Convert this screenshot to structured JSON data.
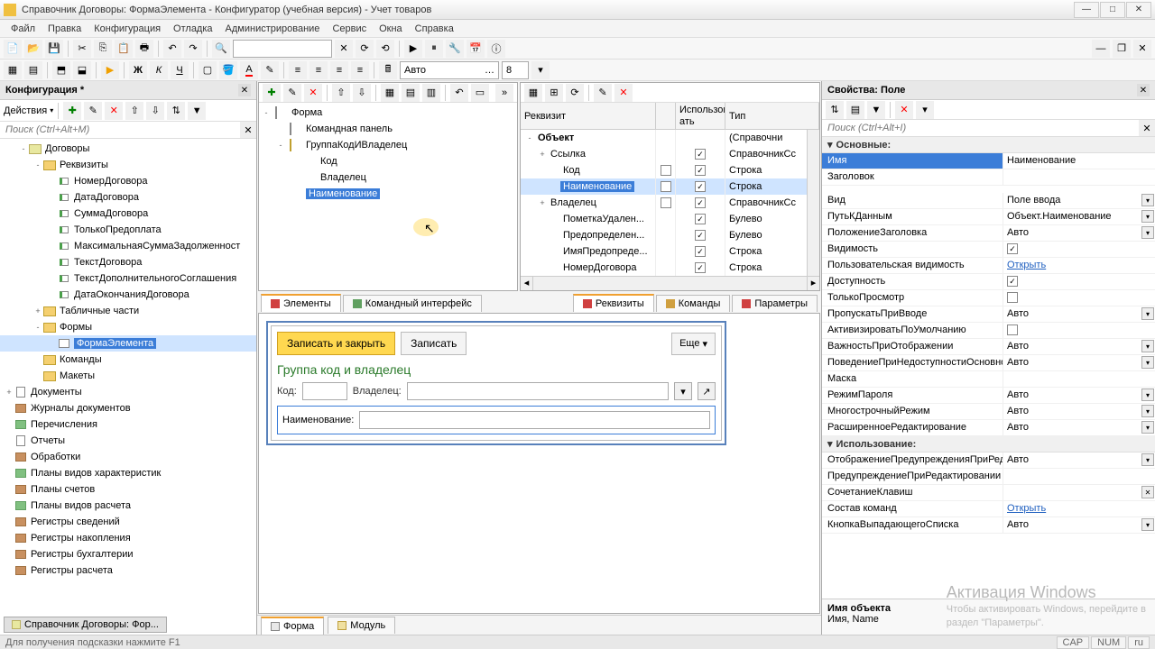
{
  "titlebar": "Справочник Договоры: ФормаЭлемента - Конфигуратор (учебная версия) - Учет товаров",
  "menu": [
    "Файл",
    "Правка",
    "Конфигурация",
    "Отладка",
    "Администрирование",
    "Сервис",
    "Окна",
    "Справка"
  ],
  "toolbar2": {
    "combo_font": "Авто",
    "combo_size": "8"
  },
  "left": {
    "title": "Конфигурация *",
    "actions": "Действия",
    "search_ph": "Поиск (Ctrl+Alt+M)",
    "tree": [
      {
        "l": 1,
        "ex": "-",
        "i": "book",
        "t": "Договоры"
      },
      {
        "l": 2,
        "ex": "-",
        "i": "folder",
        "t": "Реквизиты"
      },
      {
        "l": 3,
        "ex": "",
        "i": "attr",
        "t": "НомерДоговора"
      },
      {
        "l": 3,
        "ex": "",
        "i": "attr",
        "t": "ДатаДоговора"
      },
      {
        "l": 3,
        "ex": "",
        "i": "attr",
        "t": "СуммаДоговора"
      },
      {
        "l": 3,
        "ex": "",
        "i": "attr",
        "t": "ТолькоПредоплата"
      },
      {
        "l": 3,
        "ex": "",
        "i": "attr",
        "t": "МаксимальнаяСуммаЗадолженност"
      },
      {
        "l": 3,
        "ex": "",
        "i": "attr",
        "t": "ТекстДоговора"
      },
      {
        "l": 3,
        "ex": "",
        "i": "attr",
        "t": "ТекстДополнительногоСоглашения"
      },
      {
        "l": 3,
        "ex": "",
        "i": "attr",
        "t": "ДатаОкончанияДоговора"
      },
      {
        "l": 2,
        "ex": "+",
        "i": "folder",
        "t": "Табличные части"
      },
      {
        "l": 2,
        "ex": "-",
        "i": "folder",
        "t": "Формы"
      },
      {
        "l": 3,
        "ex": "",
        "i": "form",
        "t": "ФормаЭлемента",
        "sel": true
      },
      {
        "l": 2,
        "ex": "",
        "i": "folder",
        "t": "Команды"
      },
      {
        "l": 2,
        "ex": "",
        "i": "folder",
        "t": "Макеты"
      },
      {
        "l": 0,
        "ex": "+",
        "i": "doc",
        "t": "Документы"
      },
      {
        "l": 0,
        "ex": "",
        "i": "brown",
        "t": "Журналы документов"
      },
      {
        "l": 0,
        "ex": "",
        "i": "green",
        "t": "Перечисления"
      },
      {
        "l": 0,
        "ex": "",
        "i": "doc",
        "t": "Отчеты"
      },
      {
        "l": 0,
        "ex": "",
        "i": "brown",
        "t": "Обработки"
      },
      {
        "l": 0,
        "ex": "",
        "i": "green",
        "t": "Планы видов характеристик"
      },
      {
        "l": 0,
        "ex": "",
        "i": "brown",
        "t": "Планы счетов"
      },
      {
        "l": 0,
        "ex": "",
        "i": "green",
        "t": "Планы видов расчета"
      },
      {
        "l": 0,
        "ex": "",
        "i": "brown",
        "t": "Регистры сведений"
      },
      {
        "l": 0,
        "ex": "",
        "i": "brown",
        "t": "Регистры накопления"
      },
      {
        "l": 0,
        "ex": "",
        "i": "brown",
        "t": "Регистры бухгалтерии"
      },
      {
        "l": 0,
        "ex": "",
        "i": "brown",
        "t": "Регистры расчета"
      }
    ]
  },
  "form_tree": [
    {
      "l": 0,
      "ex": "-",
      "i": "window",
      "t": "Форма"
    },
    {
      "l": 1,
      "ex": "",
      "i": "cmdpanel",
      "t": "Командная панель"
    },
    {
      "l": 1,
      "ex": "-",
      "i": "group",
      "t": "ГруппаКодИВладелец"
    },
    {
      "l": 2,
      "ex": "",
      "i": "dash",
      "t": "Код"
    },
    {
      "l": 2,
      "ex": "",
      "i": "dash",
      "t": "Владелец"
    },
    {
      "l": 1,
      "ex": "",
      "i": "field",
      "t": "Наименование",
      "sel": true
    }
  ],
  "center_tabs_top": {
    "elements": "Элементы",
    "cmd": "Командный интерфейс",
    "req": "Реквизиты",
    "commands": "Команды",
    "params": "Параметры"
  },
  "req": {
    "headers": {
      "name": "Реквизит",
      "use": "Использов ать",
      "type": "Тип"
    },
    "rows": [
      {
        "ex": "-",
        "name": "Объект",
        "bold": true,
        "chk": "",
        "use": "",
        "type": "(Справочни"
      },
      {
        "ex": "+",
        "name": "Ссылка",
        "chk": "",
        "use": "✓",
        "type": "СправочникСс"
      },
      {
        "ex": "",
        "name": "Код",
        "chk": "□",
        "use": "✓",
        "type": "Строка"
      },
      {
        "ex": "",
        "name": "Наименование",
        "chk": "□",
        "use": "✓",
        "type": "Строка",
        "sel": true
      },
      {
        "ex": "+",
        "name": "Владелец",
        "chk": "□",
        "use": "✓",
        "type": "СправочникСс"
      },
      {
        "ex": "",
        "name": "ПометкаУдален...",
        "chk": "",
        "use": "✓",
        "type": "Булево"
      },
      {
        "ex": "",
        "name": "Предопределен...",
        "chk": "",
        "use": "✓",
        "type": "Булево"
      },
      {
        "ex": "",
        "name": "ИмяПредопреде...",
        "chk": "",
        "use": "✓",
        "type": "Строка"
      },
      {
        "ex": "",
        "name": "НомерДоговора",
        "chk": "",
        "use": "✓",
        "type": "Строка"
      }
    ]
  },
  "preview": {
    "save_close": "Записать и закрыть",
    "save": "Записать",
    "more": "Еще",
    "group": "Группа код и владелец",
    "code_lbl": "Код:",
    "owner_lbl": "Владелец:",
    "name_lbl": "Наименование:"
  },
  "bottom_tabs": {
    "form": "Форма",
    "module": "Модуль"
  },
  "right": {
    "title": "Свойства: Поле",
    "search_ph": "Поиск (Ctrl+Alt+I)",
    "sections": {
      "main": "Основные:",
      "use": "Использование:"
    },
    "props": [
      {
        "n": "Имя",
        "v": "Наименование",
        "sel": true
      },
      {
        "n": "Заголовок",
        "v": ""
      },
      {
        "sp": true
      },
      {
        "n": "Вид",
        "v": "Поле ввода",
        "dd": true
      },
      {
        "n": "ПутьКДанным",
        "v": "Объект.Наименование",
        "dd": true
      },
      {
        "n": "ПоложениеЗаголовка",
        "v": "Авто",
        "dd": true
      },
      {
        "n": "Видимость",
        "v": "",
        "chk": true
      },
      {
        "n": "Пользовательская видимость",
        "v": "Открыть",
        "link": true
      },
      {
        "n": "Доступность",
        "v": "",
        "chk": true
      },
      {
        "n": "ТолькоПросмотр",
        "v": "",
        "chk": false
      },
      {
        "n": "ПропускатьПриВводе",
        "v": "Авто",
        "dd": true
      },
      {
        "n": "АктивизироватьПоУмолчанию",
        "v": "",
        "chk": false
      },
      {
        "n": "ВажностьПриОтображении",
        "v": "Авто",
        "dd": true
      },
      {
        "n": "ПоведениеПриНедоступностиОсновно",
        "v": "Авто",
        "dd": true
      },
      {
        "n": "Маска",
        "v": ""
      },
      {
        "n": "РежимПароля",
        "v": "Авто",
        "dd": true
      },
      {
        "n": "МногострочныйРежим",
        "v": "Авто",
        "dd": true
      },
      {
        "n": "РасширенноеРедактирование",
        "v": "Авто",
        "dd": true
      }
    ],
    "props2": [
      {
        "n": "ОтображениеПредупрежденияПриРедак",
        "v": "Авто",
        "dd": true
      },
      {
        "n": "ПредупреждениеПриРедактировании",
        "v": ""
      },
      {
        "n": "СочетаниеКлавиш",
        "v": "",
        "cl": true
      },
      {
        "n": "Состав команд",
        "v": "Открыть",
        "link": true
      },
      {
        "n": "КнопкаВыпадающегоСписка",
        "v": "Авто",
        "dd": true
      }
    ],
    "hint_title": "Имя объекта",
    "hint_body": "Имя, Name"
  },
  "watermark": {
    "title": "Активация Windows",
    "body1": "Чтобы активировать Windows, перейдите в",
    "body2": "раздел \"Параметры\"."
  },
  "taskbar_tab": "Справочник Договоры: Фор...",
  "status": {
    "hint": "Для получения подсказки нажмите F1",
    "cap": "CAP",
    "num": "NUM",
    "lang": "ru"
  }
}
